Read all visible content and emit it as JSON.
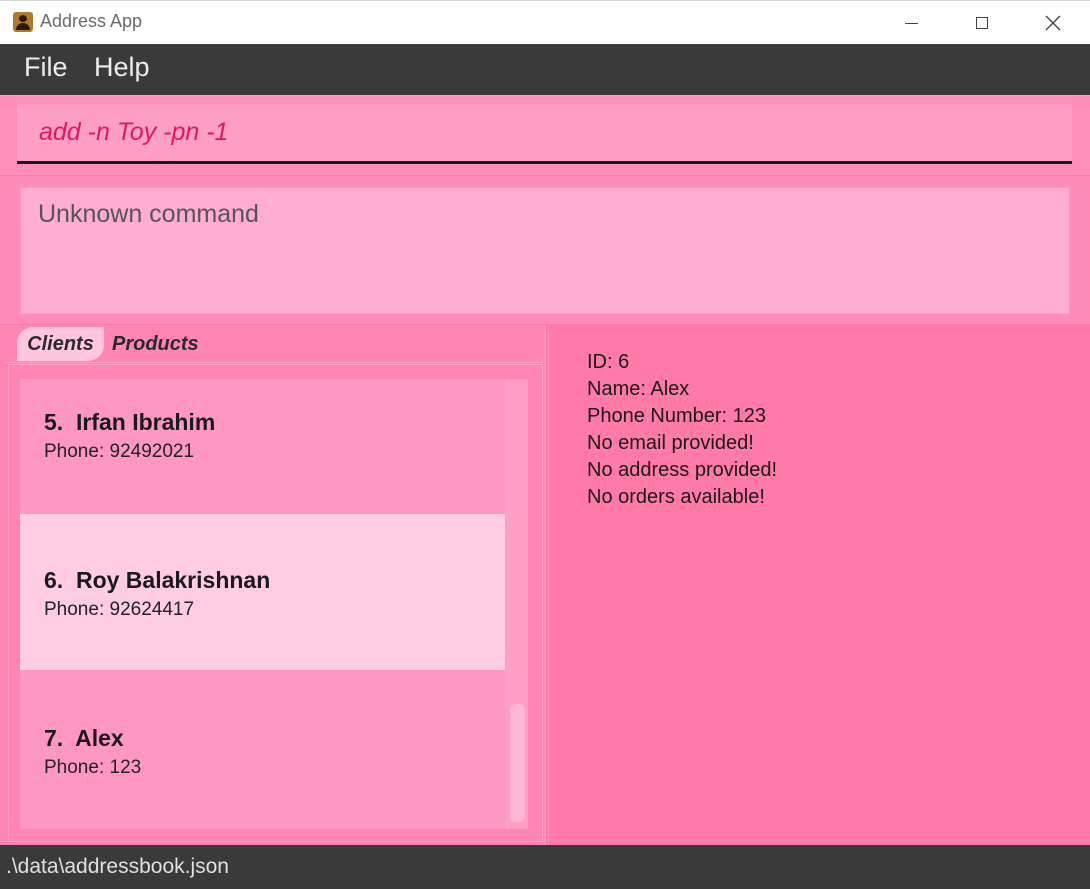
{
  "window": {
    "title": "Address App",
    "icon": "address-book-icon"
  },
  "menu": {
    "file": "File",
    "help": "Help"
  },
  "command": {
    "value": "add -n Toy -pn -1"
  },
  "result": {
    "message": "Unknown command"
  },
  "tabs": {
    "clients": "Clients",
    "products": "Products",
    "active": "Clients"
  },
  "clients": [
    {
      "index": "5.",
      "name": "Irfan Ibrahim",
      "phone": "Phone: 92492021",
      "selected": false
    },
    {
      "index": "6.",
      "name": "Roy Balakrishnan",
      "phone": "Phone: 92624417",
      "selected": true
    },
    {
      "index": "7.",
      "name": "Alex",
      "phone": "Phone: 123",
      "selected": false
    }
  ],
  "detail": {
    "id": "ID: 6",
    "name": "Name: Alex",
    "phone": "Phone Number: 123",
    "email": "No email provided!",
    "address": "No address provided!",
    "orders": "No orders available!"
  },
  "status": {
    "path": ".\\data\\addressbook.json"
  },
  "colors": {
    "accent_pink": "#ff7aa8",
    "command_text": "#e01a5a",
    "selected_card": "#ffcde1",
    "bar_dark": "#3a3a3a"
  }
}
